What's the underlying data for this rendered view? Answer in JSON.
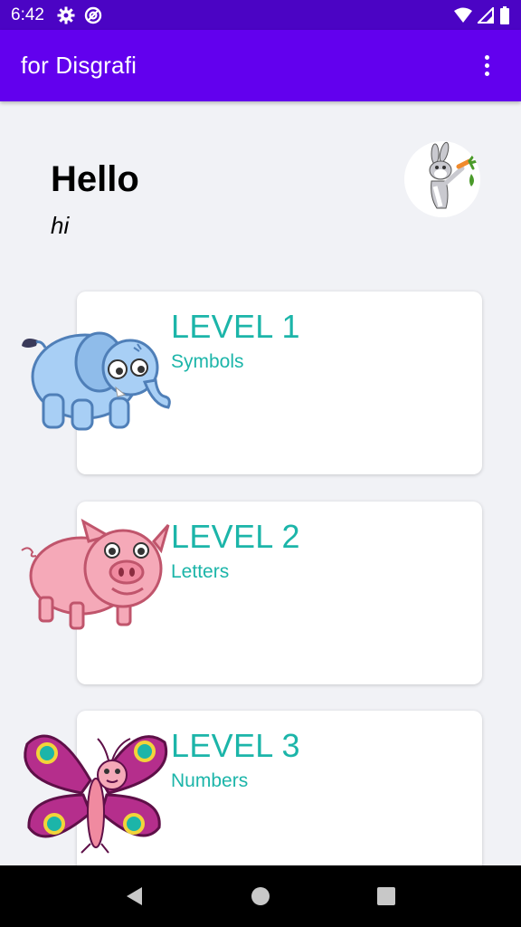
{
  "status_bar": {
    "time": "6:42",
    "left_icons": [
      "settings-icon",
      "at-sign-icon"
    ],
    "right_icons": [
      "wifi-icon",
      "signal-icon",
      "battery-icon"
    ]
  },
  "app_bar": {
    "title": "for Disgrafi",
    "overflow_icon": "more-vert-icon"
  },
  "greeting": {
    "title": "Hello",
    "subtitle": "hi"
  },
  "levels": [
    {
      "level": "LEVEL 1",
      "subtitle": "Symbols",
      "animal": "elephant"
    },
    {
      "level": "LEVEL 2",
      "subtitle": "Letters",
      "animal": "pig"
    },
    {
      "level": "LEVEL 3",
      "subtitle": "Numbers",
      "animal": "butterfly"
    }
  ],
  "colors": {
    "status_bar": "#4b04c4",
    "app_bar": "#6200ee",
    "accent_teal": "#1cb5a9",
    "background": "#f1f2f6"
  },
  "nav_bar": {
    "buttons": [
      "back-icon",
      "home-icon",
      "recents-icon"
    ]
  }
}
